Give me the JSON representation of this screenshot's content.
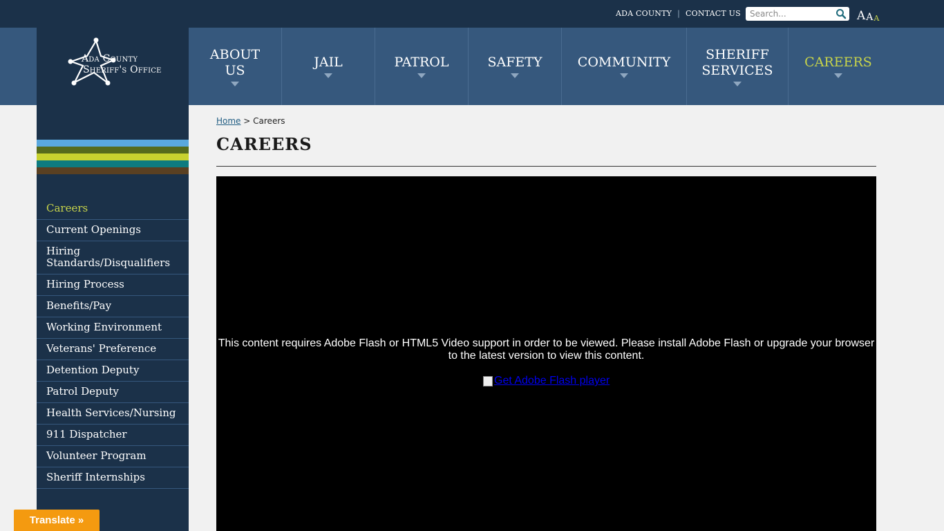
{
  "topbar": {
    "links": [
      "ADA COUNTY",
      "CONTACT US"
    ],
    "search_placeholder": "Search...",
    "text_size": [
      "A",
      "A",
      "A"
    ]
  },
  "logo": {
    "line1": "Ada County",
    "line2": "Sheriff's Office"
  },
  "nav": {
    "items": [
      {
        "label_line1": "ABOUT",
        "label_line2": "US"
      },
      {
        "label_line1": "JAIL",
        "label_line2": ""
      },
      {
        "label_line1": "PATROL",
        "label_line2": ""
      },
      {
        "label_line1": "SAFETY",
        "label_line2": ""
      },
      {
        "label_line1": "COMMUNITY",
        "label_line2": ""
      },
      {
        "label_line1": "SHERIFF",
        "label_line2": "SERVICES"
      },
      {
        "label_line1": "CAREERS",
        "label_line2": ""
      }
    ],
    "active_color": "#c8d44a"
  },
  "stripes": [
    "#5aa8de",
    "#566b1c",
    "#c8d22f",
    "#0d7b80",
    "#5a4022"
  ],
  "sidebar": {
    "items": [
      "Careers",
      "Current Openings",
      "Hiring Standards/Disqualifiers",
      "Hiring Process",
      "Benefits/Pay",
      "Working Environment",
      "Veterans' Preference",
      "Detention Deputy",
      "Patrol Deputy",
      "Health Services/Nursing",
      "911 Dispatcher",
      "Volunteer Program",
      "Sheriff Internships"
    ]
  },
  "breadcrumb": {
    "home": "Home",
    "separator": ">",
    "current": "Careers"
  },
  "page": {
    "title": "CAREERS"
  },
  "video": {
    "message": "This content requires Adobe Flash or HTML5 Video support in order to be viewed. Please install Adobe Flash or upgrade your browser to the latest version to view this content.",
    "link_text": "Get Adobe Flash player"
  },
  "translate": {
    "label": "Translate »"
  }
}
